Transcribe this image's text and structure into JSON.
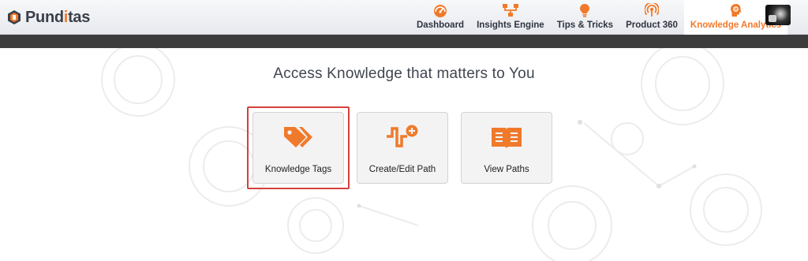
{
  "brand": {
    "name_prefix": "Pund",
    "name_accent": "i",
    "name_suffix": "tas",
    "accent_color": "#f07a2b"
  },
  "nav": {
    "items": [
      {
        "label": "Dashboard",
        "icon": "speedometer-icon"
      },
      {
        "label": "Insights Engine",
        "icon": "network-icon"
      },
      {
        "label": "Tips & Tricks",
        "icon": "lightbulb-icon"
      },
      {
        "label": "Product 360",
        "icon": "broadcast-icon"
      },
      {
        "label": "Knowledge Analytics",
        "icon": "brain-gear-icon",
        "active": true
      }
    ]
  },
  "main": {
    "title": "Access Knowledge that matters to You",
    "cards": [
      {
        "label": "Knowledge Tags",
        "icon": "tags-icon",
        "highlighted": true
      },
      {
        "label": "Create/Edit Path",
        "icon": "path-add-icon"
      },
      {
        "label": "View Paths",
        "icon": "book-icon"
      }
    ]
  },
  "colors": {
    "highlight_border": "#d5413d",
    "icon_orange": "#f07a2b",
    "dark_strip": "#3c3c3c"
  }
}
